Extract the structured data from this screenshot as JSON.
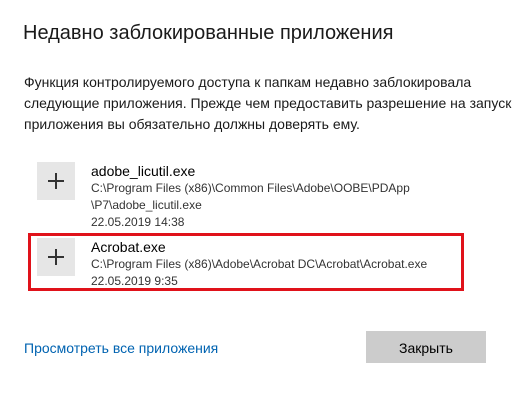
{
  "dialog": {
    "title": "Недавно заблокированные приложения",
    "description": "Функция контролируемого доступа к папкам недавно заблокировала следующие приложения. Прежде чем предоставить разрешение на запуск приложения вы обязательно должны доверять ему."
  },
  "apps": [
    {
      "icon": "plus-icon",
      "name": "adobe_licutil.exe",
      "path_line1": "C:\\Program Files (x86)\\Common Files\\Adobe\\OOBE\\PDApp",
      "path_line2": "\\P7\\adobe_licutil.exe",
      "timestamp": "22.05.2019 14:38"
    },
    {
      "icon": "plus-icon",
      "name": "Acrobat.exe",
      "path_line1": "C:\\Program Files (x86)\\Adobe\\Acrobat DC\\Acrobat\\Acrobat.exe",
      "timestamp": "22.05.2019 9:35",
      "highlighted": true
    }
  ],
  "footer": {
    "view_all_link": "Просмотреть все приложения",
    "close_button": "Закрыть"
  },
  "colors": {
    "link": "#0063b1",
    "highlight_border": "#e0121a",
    "button_bg": "#cccccc",
    "tile_bg": "#e6e6e6"
  }
}
